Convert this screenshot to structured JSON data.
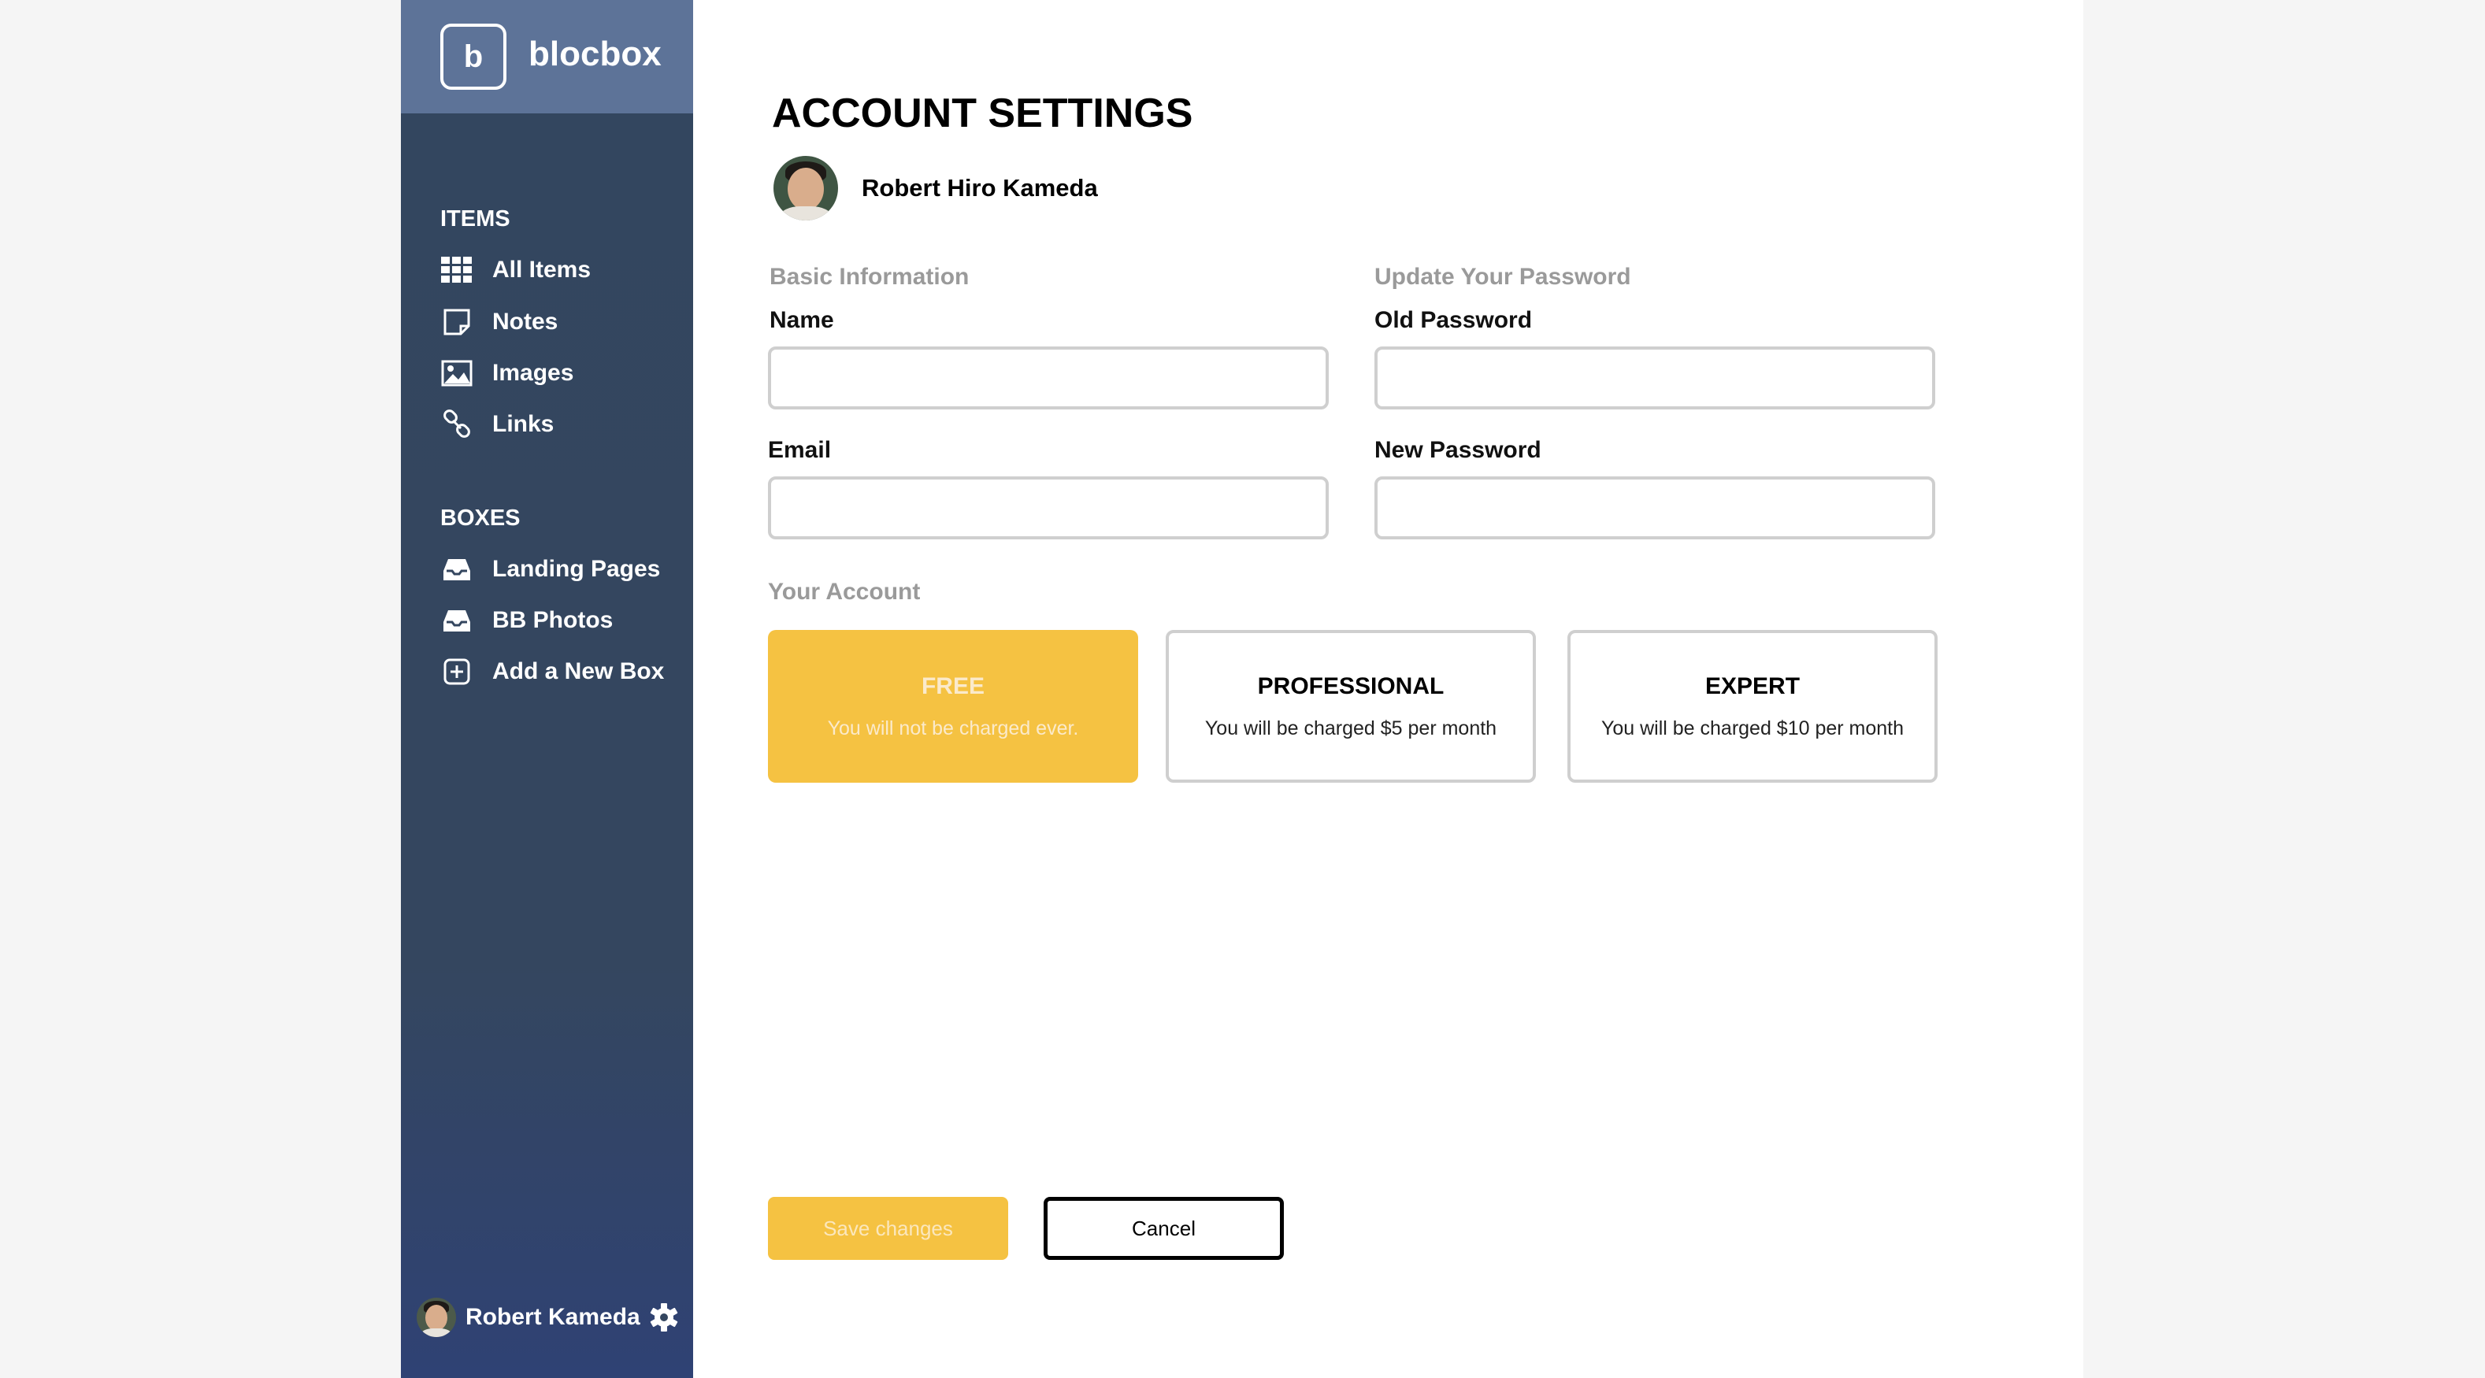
{
  "brand": {
    "letter": "b",
    "name": "blocbox"
  },
  "sidebar": {
    "items_heading": "ITEMS",
    "items": [
      {
        "label": "All Items",
        "icon": "grid-icon"
      },
      {
        "label": "Notes",
        "icon": "note-icon"
      },
      {
        "label": "Images",
        "icon": "image-icon"
      },
      {
        "label": "Links",
        "icon": "link-icon"
      }
    ],
    "boxes_heading": "BOXES",
    "boxes": [
      {
        "label": "Landing Pages",
        "icon": "inbox-icon"
      },
      {
        "label": "BB Photos",
        "icon": "inbox-icon"
      },
      {
        "label": "Add a New Box",
        "icon": "plus-square-icon"
      }
    ],
    "user_name": "Robert Kameda"
  },
  "main": {
    "title": "ACCOUNT SETTINGS",
    "profile_name": "Robert Hiro Kameda",
    "basic_info": {
      "heading": "Basic Information",
      "name_label": "Name",
      "name_value": "",
      "email_label": "Email",
      "email_value": ""
    },
    "password": {
      "heading": "Update Your Password",
      "old_label": "Old Password",
      "old_value": "",
      "new_label": "New Password",
      "new_value": ""
    },
    "account": {
      "heading": "Your Account",
      "plans": [
        {
          "title": "FREE",
          "desc": "You will not be charged ever.",
          "selected": true
        },
        {
          "title": "PROFESSIONAL",
          "desc": "You will be charged $5 per month",
          "selected": false
        },
        {
          "title": "EXPERT",
          "desc": "You will be charged $10 per month",
          "selected": false
        }
      ]
    },
    "save_label": "Save changes",
    "cancel_label": "Cancel"
  },
  "colors": {
    "accent": "#f5c242",
    "sidebar": "#34465f",
    "brand_bar": "#5d7398"
  }
}
